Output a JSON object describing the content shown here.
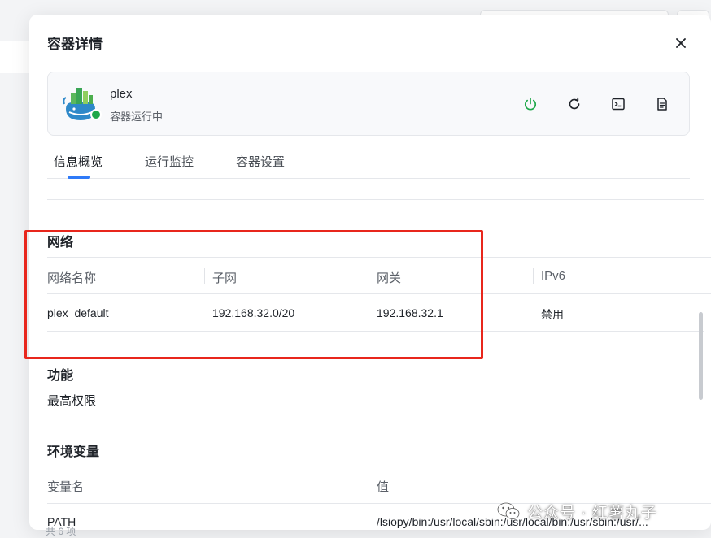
{
  "dialog": {
    "title": "容器详情",
    "close_icon": "close-icon"
  },
  "container": {
    "name": "plex",
    "status": "容器运行中",
    "status_color": "#1fa84a",
    "actions": [
      {
        "icon": "power-icon",
        "color": "#1fa84a"
      },
      {
        "icon": "restart-icon",
        "color": "#1f2329"
      },
      {
        "icon": "terminal-icon",
        "color": "#1f2329"
      },
      {
        "icon": "log-file-icon",
        "color": "#1f2329"
      }
    ]
  },
  "tabs": [
    {
      "label": "信息概览",
      "active": true
    },
    {
      "label": "运行监控",
      "active": false
    },
    {
      "label": "容器设置",
      "active": false
    }
  ],
  "network": {
    "title": "网络",
    "columns": [
      "网络名称",
      "子网",
      "网关",
      "IPv6"
    ],
    "rows": [
      [
        "plex_default",
        "192.168.32.0/20",
        "192.168.32.1",
        "禁用"
      ]
    ]
  },
  "capabilities": {
    "title": "功能",
    "value": "最高权限"
  },
  "env": {
    "title": "环境变量",
    "columns": [
      "变量名",
      "值"
    ],
    "rows": [
      [
        "PATH",
        "/lsiopy/bin:/usr/local/sbin:/usr/local/bin:/usr/sbin:/usr/..."
      ]
    ]
  },
  "footer_peek": "共 6 项",
  "highlight_color": "#e8261c",
  "accent_color": "#2f7af8",
  "watermark": "公众号 · 红薯丸子"
}
